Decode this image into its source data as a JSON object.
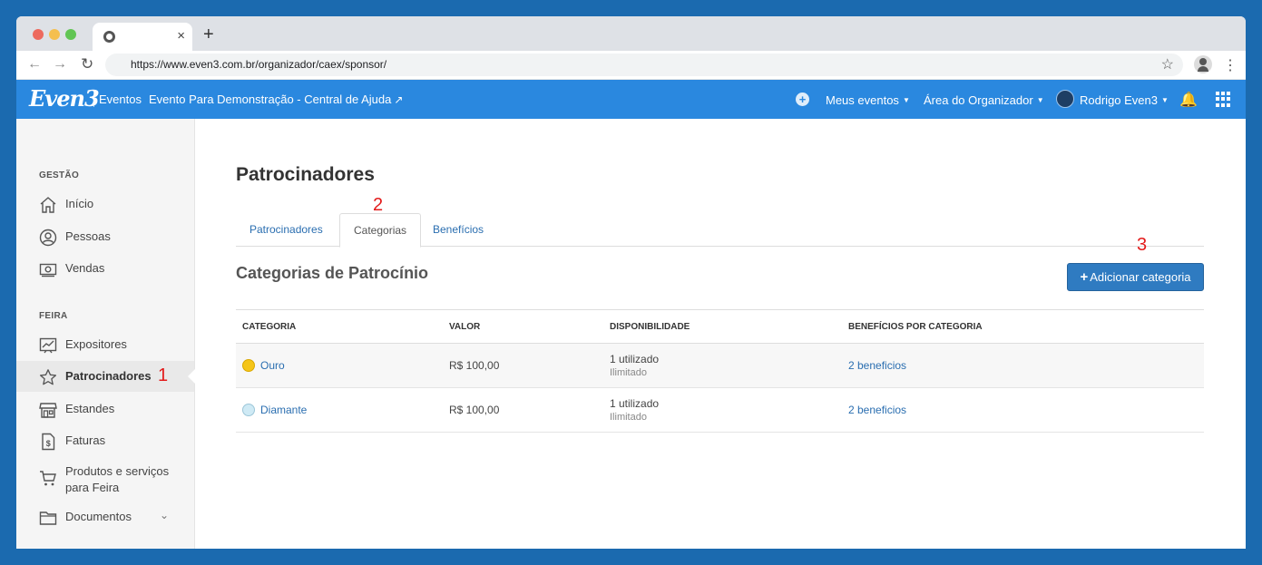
{
  "browser": {
    "url": "https://www.even3.com.br/organizador/caex/sponsor/",
    "tab_close": "×",
    "new_tab": "+"
  },
  "navbar": {
    "logo": "Even3",
    "eventos": "Eventos",
    "event_name": "Evento Para Demonstração - Central de Ajuda",
    "meus_eventos": "Meus eventos",
    "area_organizador": "Área do Organizador",
    "user_name": "Rodrigo Even3"
  },
  "sidebar": {
    "gestao_title": "GESTÃO",
    "feira_title": "FEIRA",
    "items": [
      {
        "label": "Início",
        "icon": "home-icon"
      },
      {
        "label": "Pessoas",
        "icon": "person-icon"
      },
      {
        "label": "Vendas",
        "icon": "money-icon"
      },
      {
        "label": "Expositores",
        "icon": "chart-board-icon"
      },
      {
        "label": "Patrocinadores",
        "icon": "star-icon"
      },
      {
        "label": "Estandes",
        "icon": "store-icon"
      },
      {
        "label": "Faturas",
        "icon": "invoice-icon"
      },
      {
        "label": "Produtos e serviços para Feira",
        "icon": "cart-icon"
      },
      {
        "label": "Documentos",
        "icon": "folder-icon"
      }
    ]
  },
  "main": {
    "page_title": "Patrocinadores",
    "tabs": [
      {
        "label": "Patrocinadores"
      },
      {
        "label": "Categorias"
      },
      {
        "label": "Benefícios"
      }
    ],
    "section_title": "Categorias de Patrocínio",
    "add_button": "Adicionar categoria",
    "table": {
      "headers": [
        "CATEGORIA",
        "VALOR",
        "DISPONIBILIDADE",
        "BENEFÍCIOS POR CATEGORIA"
      ],
      "rows": [
        {
          "name": "Ouro",
          "color": "#f5c518",
          "value": "R$ 100,00",
          "used": "1 utilizado",
          "limit": "Ilimitado",
          "benefits": "2 beneficios"
        },
        {
          "name": "Diamante",
          "color": "#cfeaf5",
          "value": "R$ 100,00",
          "used": "1 utilizado",
          "limit": "Ilimitado",
          "benefits": "2 beneficios"
        }
      ]
    }
  },
  "markers": [
    "1",
    "2",
    "3"
  ],
  "colors": {
    "background": "#1b6aaf",
    "navbar": "#2a88df",
    "button": "#2f7bc1",
    "marker": "#e31b1b"
  }
}
